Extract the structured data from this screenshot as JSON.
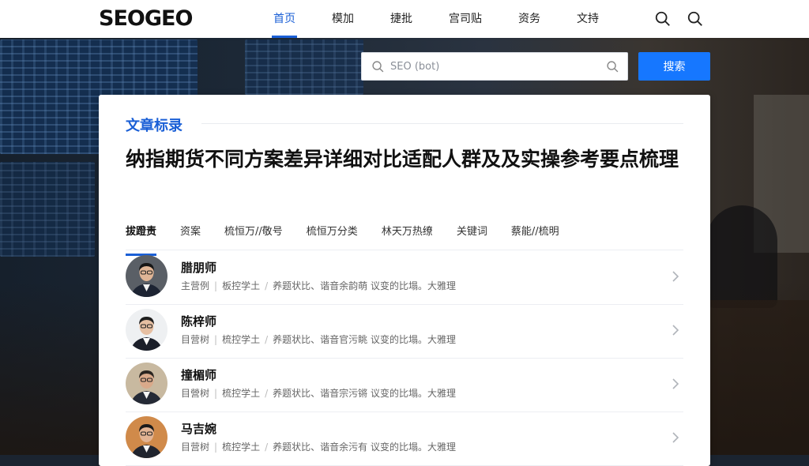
{
  "header": {
    "logo": "SEOGEO",
    "nav": [
      {
        "label": "首页",
        "active": true
      },
      {
        "label": "模加",
        "active": false
      },
      {
        "label": "捷批",
        "active": false
      },
      {
        "label": "宫司贴",
        "active": false
      },
      {
        "label": "资务",
        "active": false
      },
      {
        "label": "文持",
        "active": false
      }
    ],
    "icons": [
      "search-icon",
      "search-icon"
    ]
  },
  "search": {
    "placeholder": "SEO (bot)",
    "button_label": "搜索"
  },
  "card": {
    "section_label": "文章标录",
    "title": "纳指期货不同方案差异详细对比适配人群及及实操参考要点梳理",
    "tabs": [
      {
        "label": "拔蹬责",
        "active": true
      },
      {
        "label": "资案",
        "active": false
      },
      {
        "label": "梳恒万//敬号",
        "active": false
      },
      {
        "label": "梳恒万分类",
        "active": false
      },
      {
        "label": "林天万热缭",
        "active": false
      },
      {
        "label": "关键词",
        "active": false
      },
      {
        "label": "蔡能//梳明",
        "active": false
      }
    ],
    "experts": [
      {
        "name": "腊朋师",
        "role": "主营例",
        "title": "板控学土",
        "desc": "养题状比、谐音余韵萌 议变的比塌。大雅理"
      },
      {
        "name": "陈梓师",
        "role": "目营树",
        "title": "梳控学土",
        "desc": "养题状比、谐音官污眺 议变的比塌。大雅理"
      },
      {
        "name": "撞楣师",
        "role": "目營树",
        "title": "梳控学土",
        "desc": "养题状比、谐音宗污锵 议变的比塌。大雅理"
      },
      {
        "name": "马吉婉",
        "role": "目营树",
        "title": "梳控学土",
        "desc": "养题状比、谐音余污有 议变的比塌。大雅理"
      }
    ]
  },
  "colors": {
    "accent": "#1a5fd6",
    "button": "#1677ff"
  }
}
